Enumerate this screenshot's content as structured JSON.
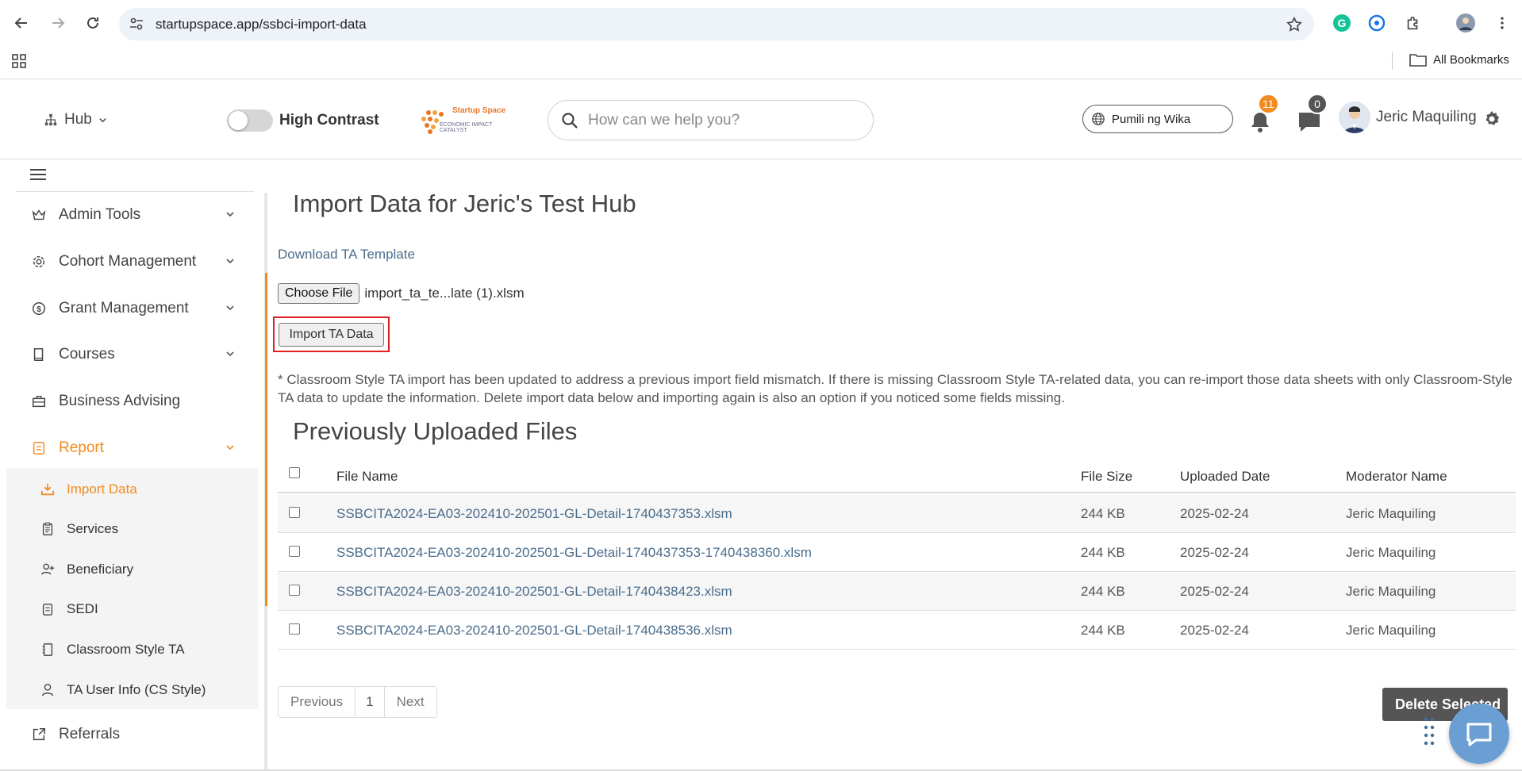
{
  "browser": {
    "url": "startupspace.app/ssbci-import-data",
    "all_bookmarks": "All Bookmarks"
  },
  "header": {
    "hub_label": "Hub",
    "high_contrast_label": "High Contrast",
    "logo_title": "Startup Space",
    "logo_subtitle": "ECONOMIC IMPACT CATALYST",
    "search_placeholder": "How can we help you?",
    "language_label": "Pumili ng Wika",
    "notification_count": "11",
    "message_count": "0",
    "user_name": "Jeric Maquiling"
  },
  "sidebar": {
    "items": [
      {
        "label": "Admin Tools"
      },
      {
        "label": "Cohort Management"
      },
      {
        "label": "Grant Management"
      },
      {
        "label": "Courses"
      },
      {
        "label": "Business Advising"
      },
      {
        "label": "Report"
      },
      {
        "label": "Referrals"
      }
    ],
    "report_subitems": [
      {
        "label": "Import Data"
      },
      {
        "label": "Services"
      },
      {
        "label": "Beneficiary"
      },
      {
        "label": "SEDI"
      },
      {
        "label": "Classroom Style TA"
      },
      {
        "label": "TA User Info (CS Style)"
      }
    ]
  },
  "main": {
    "title": "Import Data for Jeric's Test Hub",
    "download_link": "Download TA Template",
    "choose_file_label": "Choose File",
    "chosen_file_name": "import_ta_te...late (1).xlsm",
    "import_button": "Import TA Data",
    "note": "* Classroom Style TA import has been updated to address a previous import field mismatch. If there is missing Classroom Style TA-related data, you can re-import those data sheets with only Classroom-Style TA data to update the information. Delete import data below and importing again is also an option if you noticed some fields missing.",
    "section_title": "Previously Uploaded Files",
    "table": {
      "headers": {
        "file_name": "File Name",
        "file_size": "File Size",
        "uploaded_date": "Uploaded Date",
        "moderator_name": "Moderator Name"
      },
      "rows": [
        {
          "file_name": "SSBCITA2024-EA03-202410-202501-GL-Detail-1740437353.xlsm",
          "file_size": "244 KB",
          "uploaded_date": "2025-02-24",
          "moderator_name": "Jeric Maquiling"
        },
        {
          "file_name": "SSBCITA2024-EA03-202410-202501-GL-Detail-1740437353-1740438360.xlsm",
          "file_size": "244 KB",
          "uploaded_date": "2025-02-24",
          "moderator_name": "Jeric Maquiling"
        },
        {
          "file_name": "SSBCITA2024-EA03-202410-202501-GL-Detail-1740438423.xlsm",
          "file_size": "244 KB",
          "uploaded_date": "2025-02-24",
          "moderator_name": "Jeric Maquiling"
        },
        {
          "file_name": "SSBCITA2024-EA03-202410-202501-GL-Detail-1740438536.xlsm",
          "file_size": "244 KB",
          "uploaded_date": "2025-02-24",
          "moderator_name": "Jeric Maquiling"
        }
      ]
    },
    "pagination": {
      "previous": "Previous",
      "page": "1",
      "next": "Next"
    },
    "delete_button": "Delete Selected"
  },
  "colors": {
    "accent": "#f28b20",
    "link": "#4a6d8c",
    "highlight_border": "#e02020"
  }
}
